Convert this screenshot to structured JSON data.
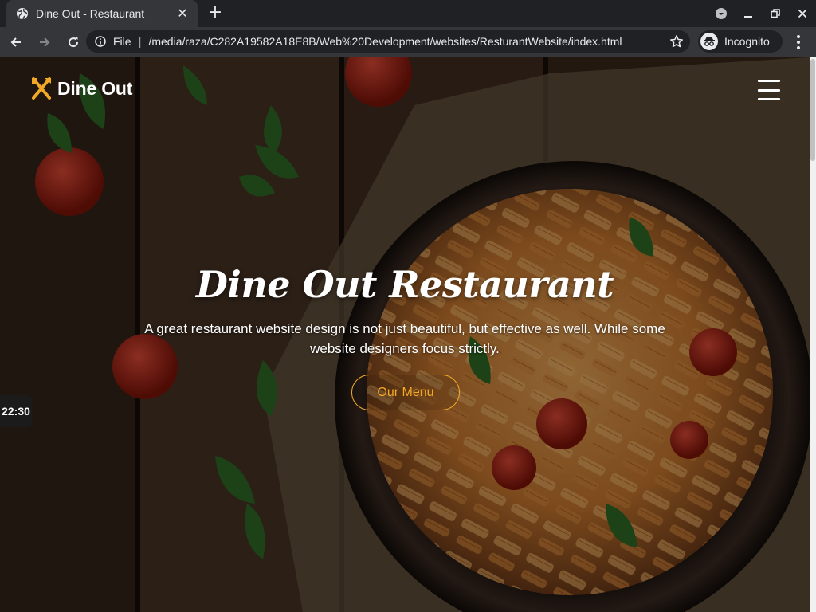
{
  "browser": {
    "tab": {
      "title": "Dine Out - Restaurant",
      "favicon": "globe-icon",
      "close_icon": "close-icon"
    },
    "new_tab_icon": "plus-icon",
    "window_controls": [
      "dropdown-icon",
      "minimize-icon",
      "restore-icon",
      "close-icon"
    ],
    "nav": {
      "back": "arrow-left-icon",
      "forward": "arrow-right-icon",
      "reload": "reload-icon"
    },
    "address_bar": {
      "scheme_label": "File",
      "separator": "|",
      "url": "/media/raza/C282A19582A18E8B/Web%20Development/websites/ResturantWebsite/index.html",
      "bookmark_icon": "star-icon"
    },
    "profile": {
      "label": "Incognito",
      "icon": "incognito-icon"
    },
    "menu_icon": "kebab-menu-icon"
  },
  "site": {
    "logo_text": "Dine Out",
    "logo_icon": "fork-spoon-icon",
    "menu_icon": "hamburger-icon",
    "hero": {
      "title": "Dine Out Restaurant",
      "subtitle": "A great restaurant website design is not just beautiful, but effective as well. While some website designers focus strictly.",
      "cta_label": "Our Menu"
    },
    "accent_color": "#f1a926"
  },
  "overlay_widget": {
    "time": "22:30"
  }
}
